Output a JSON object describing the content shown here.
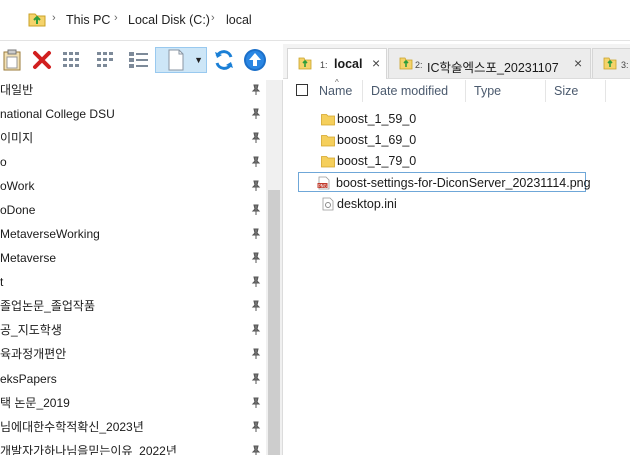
{
  "address": {
    "crumbs": [
      "This PC",
      "Local Disk (C:)",
      "local"
    ]
  },
  "toolbar": {
    "buttons": [
      "paste",
      "delete",
      "view-details",
      "view-list",
      "view-icons",
      "new-file",
      "refresh",
      "up"
    ]
  },
  "sidebar": {
    "items": [
      {
        "label": "대일반",
        "pinned": true
      },
      {
        "label": "national College DSU",
        "pinned": true
      },
      {
        "label": "이미지",
        "pinned": true
      },
      {
        "label": "o",
        "pinned": true
      },
      {
        "label": "oWork",
        "pinned": true
      },
      {
        "label": "oDone",
        "pinned": true
      },
      {
        "label": "MetaverseWorking",
        "pinned": true
      },
      {
        "label": "Metaverse",
        "pinned": true
      },
      {
        "label": "t",
        "pinned": true
      },
      {
        "label": "졸업논문_졸업작품",
        "pinned": true
      },
      {
        "label": "공_지도학생",
        "pinned": true
      },
      {
        "label": "육과정개편안",
        "pinned": true
      },
      {
        "label": "eksPapers",
        "pinned": true
      },
      {
        "label": "택 논문_2019",
        "pinned": true
      },
      {
        "label": "님에대한수학적확신_2023년",
        "pinned": true
      },
      {
        "label": "개발자가하나님을믿는이유_2022년",
        "pinned": true
      }
    ]
  },
  "tabs": [
    {
      "num": "1:",
      "label": "local",
      "active": true,
      "close": "×"
    },
    {
      "num": "2:",
      "label": "IC학술엑스포_20231107",
      "active": false,
      "close": "×"
    },
    {
      "num": "3:",
      "label": "",
      "active": false,
      "close": ""
    }
  ],
  "columns": {
    "name": "Name",
    "date": "Date modified",
    "type": "Type",
    "size": "Size"
  },
  "files": [
    {
      "name": "boost_1_59_0",
      "kind": "folder",
      "selected": false
    },
    {
      "name": "boost_1_69_0",
      "kind": "folder",
      "selected": false
    },
    {
      "name": "boost_1_79_0",
      "kind": "folder",
      "selected": false
    },
    {
      "name": "boost-settings-for-DiconServer_20231114.png",
      "kind": "png",
      "selected": true
    },
    {
      "name": "desktop.ini",
      "kind": "ini",
      "selected": false
    }
  ],
  "colors": {
    "accent": "#0078d7",
    "folder": "#f2c94c",
    "selection_border": "#6fa7d8"
  }
}
